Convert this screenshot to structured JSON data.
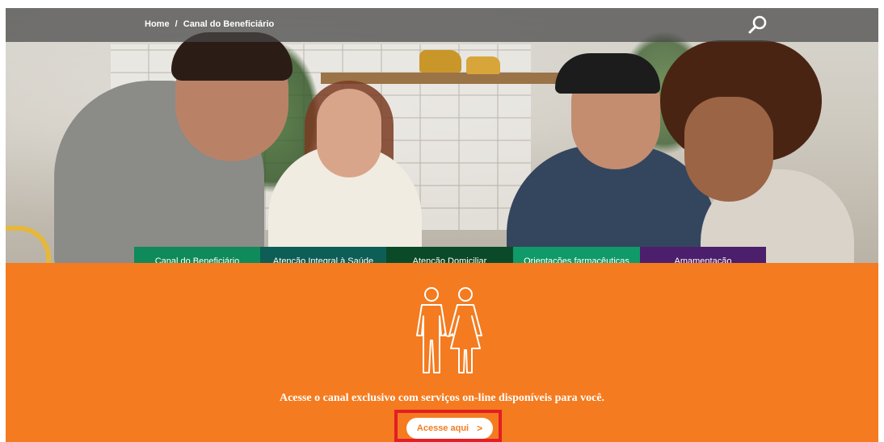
{
  "breadcrumb": {
    "home": "Home",
    "separator": "/",
    "current": "Canal do Beneficiário"
  },
  "search": {
    "icon": "search-icon"
  },
  "tabs": [
    {
      "label": "Canal do Beneficiário",
      "color": "#0f8a5a"
    },
    {
      "label": "Atenção Integral à Saúde",
      "color": "#0d5e56"
    },
    {
      "label": "Atenção Domiciliar",
      "color": "#0b4a28"
    },
    {
      "label": "Orientações farmacêuticas",
      "color": "#109a6a"
    },
    {
      "label": "Amamentação",
      "color": "#4b1f6b"
    }
  ],
  "panel": {
    "icon": "couple-icon",
    "tagline": "Acesse o canal exclusivo com serviços on-line disponíveis para você.",
    "cta_label": "Acesse aqui",
    "cta_chevron": ">",
    "background_color": "#f47b20",
    "highlight_color": "#e31e24"
  }
}
